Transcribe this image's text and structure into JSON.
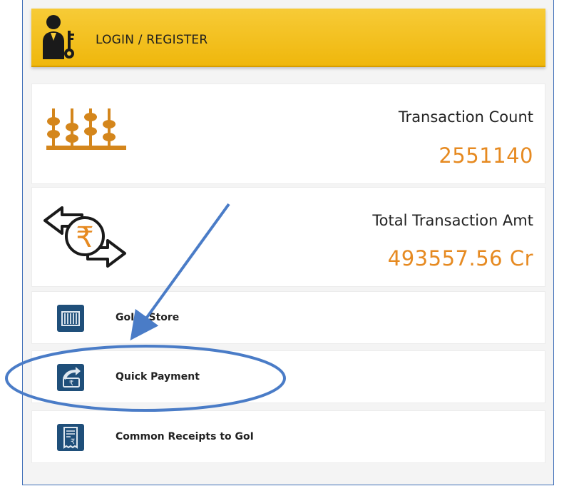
{
  "header": {
    "login_label": "LOGIN / REGISTER",
    "user_icon": "user-key-icon"
  },
  "stats": {
    "count_label": "Transaction Count",
    "count_value": "2551140",
    "amount_label": "Total Transaction Amt",
    "amount_value": "493557.56 Cr",
    "count_icon": "abacus-icon",
    "amount_icon": "rupee-exchange-icon"
  },
  "menu": {
    "items": [
      {
        "label": "GoI e-Store",
        "icon": "store-icon"
      },
      {
        "label": "Quick Payment",
        "icon": "payment-icon"
      },
      {
        "label": "Common Receipts to GoI",
        "icon": "receipt-icon"
      }
    ]
  },
  "colors": {
    "login_bar": "#f3bf1c",
    "value_orange": "#e68a21",
    "icon_navy": "#1f4f7a",
    "annotation_blue": "#4a7cc7"
  }
}
